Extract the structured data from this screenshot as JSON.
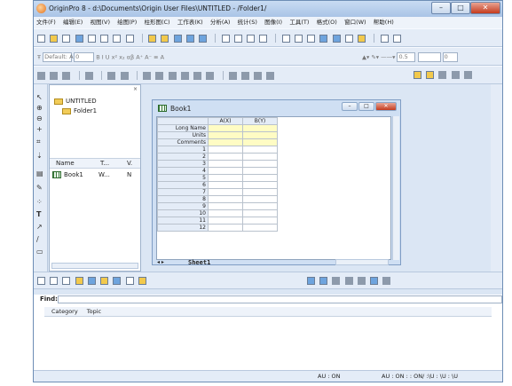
{
  "window": {
    "title": "OriginPro 8 - d:\\Documents\\Origin User Files\\UNTITLED - /Folder1/",
    "minimize": "–",
    "maximize": "□",
    "close": "✕"
  },
  "menu": [
    "文件(F)",
    "编辑(E)",
    "视图(V)",
    "绘图(P)",
    "柱形图(C)",
    "工作表(K)",
    "分析(A)",
    "统计(S)",
    "图像(I)",
    "工具(T)",
    "格式(O)",
    "窗口(W)",
    "帮助(H)"
  ],
  "format_toolbar": {
    "font": "Default: A",
    "size": "0",
    "bold": "B",
    "italic": "I",
    "underline": "U",
    "x2": "x²",
    "xsub": "x₂",
    "line_width": "0.5",
    "fill_value": "0"
  },
  "explorer": {
    "root": "UNTITLED",
    "folder": "Folder1",
    "close": "×",
    "columns": [
      "Name",
      "T...",
      "V."
    ],
    "items": [
      {
        "name": "Book1",
        "type": "W...",
        "view": "N"
      }
    ]
  },
  "book": {
    "title": "Book1",
    "columns": [
      "A(X)",
      "B(Y)"
    ],
    "meta_rows": [
      "Long Name",
      "Units",
      "Comments"
    ],
    "rows": [
      "1",
      "2",
      "3",
      "4",
      "5",
      "6",
      "7",
      "8",
      "9",
      "10",
      "11",
      "12"
    ],
    "sheet_tab": "Sheet1"
  },
  "find": {
    "label": "Find:",
    "headers": [
      "Category",
      "Topic"
    ]
  },
  "status": {
    "left": "AU : ON",
    "right": "AU : ON : : ON/ :\\U : \\U : \\U"
  }
}
